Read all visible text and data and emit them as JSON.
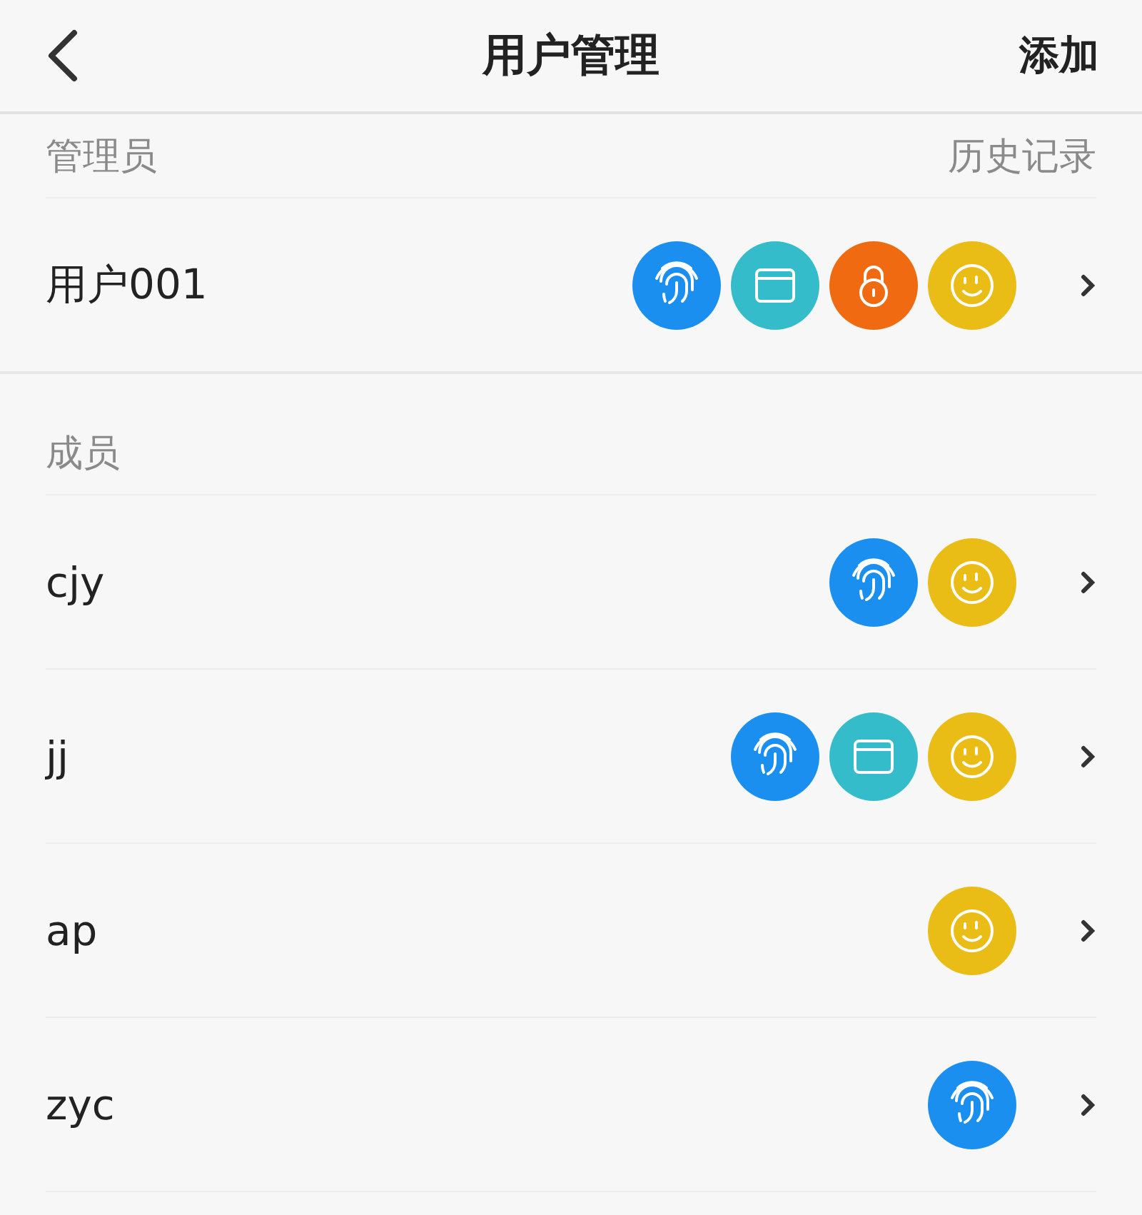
{
  "header": {
    "title": "用户管理",
    "action": "添加"
  },
  "sections": [
    {
      "label": "管理员",
      "link": "历史记录",
      "users": [
        {
          "name": "用户001",
          "methods": [
            {
              "kind": "fingerprint"
            },
            {
              "kind": "card"
            },
            {
              "kind": "password"
            },
            {
              "kind": "face"
            }
          ]
        }
      ]
    },
    {
      "label": "成员",
      "users": [
        {
          "name": "cjy",
          "methods": [
            {
              "kind": "fingerprint"
            },
            {
              "kind": "face"
            }
          ]
        },
        {
          "name": "jj",
          "methods": [
            {
              "kind": "fingerprint"
            },
            {
              "kind": "card"
            },
            {
              "kind": "face"
            }
          ]
        },
        {
          "name": "ap",
          "methods": [
            {
              "kind": "face"
            }
          ]
        },
        {
          "name": "zyc",
          "methods": [
            {
              "kind": "fingerprint"
            }
          ]
        }
      ]
    }
  ]
}
